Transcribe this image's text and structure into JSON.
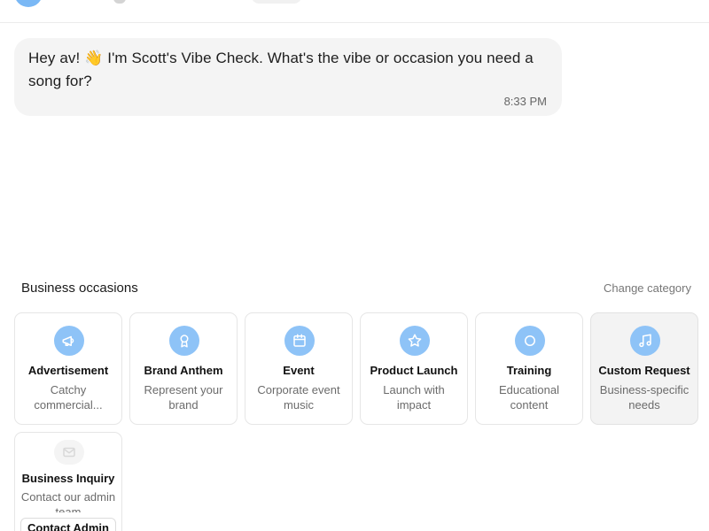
{
  "chat": {
    "message": "Hey av! 👋 I'm Scott's Vibe Check. What's the vibe or occasion you need a song for?",
    "time": "8:33 PM"
  },
  "section": {
    "label": "Business occasions",
    "change_label": "Change category"
  },
  "occasions": [
    {
      "icon": "megaphone-icon",
      "name": "Advertisement",
      "desc": "Catchy commercial..."
    },
    {
      "icon": "award-icon",
      "name": "Brand Anthem",
      "desc": "Represent your brand"
    },
    {
      "icon": "calendar-icon",
      "name": "Event",
      "desc": "Corporate event music"
    },
    {
      "icon": "star-icon",
      "name": "Product Launch",
      "desc": "Launch with impact"
    },
    {
      "icon": "circle-icon",
      "name": "Training",
      "desc": "Educational content"
    },
    {
      "icon": "music-note-icon",
      "name": "Custom Request",
      "desc": "Business-specific needs",
      "selected": true
    }
  ],
  "inquiry": {
    "icon": "mail-icon",
    "name": "Business Inquiry",
    "desc": "Contact our admin team",
    "button_label": "Contact Admin"
  },
  "colors": {
    "accent": "#8ec3f7",
    "bubble_bg": "#f4f4f4",
    "selected_card_bg": "#f3f3f3"
  }
}
